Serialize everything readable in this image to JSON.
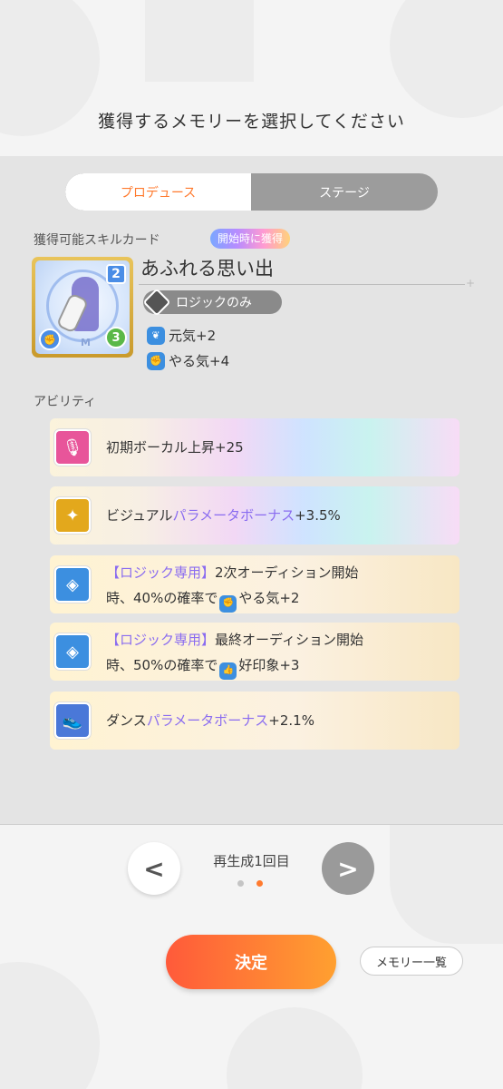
{
  "header": {
    "title": "獲得するメモリーを選択してください"
  },
  "tabs": [
    {
      "label": "プロデュース",
      "active": true
    },
    {
      "label": "ステージ",
      "active": false
    }
  ],
  "skill_section": {
    "label": "獲得可能スキルカード",
    "badge": "開始時に獲得",
    "card": {
      "name": "あふれる思い出",
      "cost": "2",
      "power": "3",
      "logo": "M",
      "restriction": "ロジックのみ",
      "effects": [
        {
          "icon": "genki-icon",
          "text": "元気+2"
        },
        {
          "icon": "yaruki-icon",
          "text": "やる気+4"
        }
      ]
    }
  },
  "ability_section": {
    "label": "アビリティ",
    "items": [
      {
        "icon": "microphone-icon",
        "color": "#e8559a",
        "pre": "",
        "highlight": "",
        "text": "初期ボーカル上昇+25",
        "line2": ""
      },
      {
        "icon": "visual-icon",
        "color": "#e3a81c",
        "pre": "ビジュアル",
        "highlight": "パラメータボーナス",
        "text": "+3.5%",
        "line2": ""
      },
      {
        "icon": "logic-icon",
        "color": "#3c8fe0",
        "pre": "",
        "highlight": "【ロジック専用】",
        "text": "2次オーディション開始",
        "line2_pre": "時、40%の確率で",
        "line2_icon": "yaruki-icon",
        "line2_text": "やる気+2"
      },
      {
        "icon": "logic-icon",
        "color": "#3c8fe0",
        "pre": "",
        "highlight": "【ロジック専用】",
        "text": "最終オーディション開始",
        "line2_pre": "時、50%の確率で",
        "line2_icon": "koinshou-icon",
        "line2_text": "好印象+3"
      },
      {
        "icon": "dance-icon",
        "color": "#4a78d8",
        "pre": "ダンス",
        "highlight": "パラメータボーナス",
        "text": "+2.1%",
        "line2": ""
      }
    ]
  },
  "footer": {
    "regen_label": "再生成1回目",
    "prev": "<",
    "next": ">",
    "page_index": 1,
    "page_count": 2,
    "decide_label": "決定",
    "memory_list_label": "メモリー一覧"
  },
  "colors": {
    "accent": "#ff7a2e",
    "highlight": "#8a6cf0"
  }
}
